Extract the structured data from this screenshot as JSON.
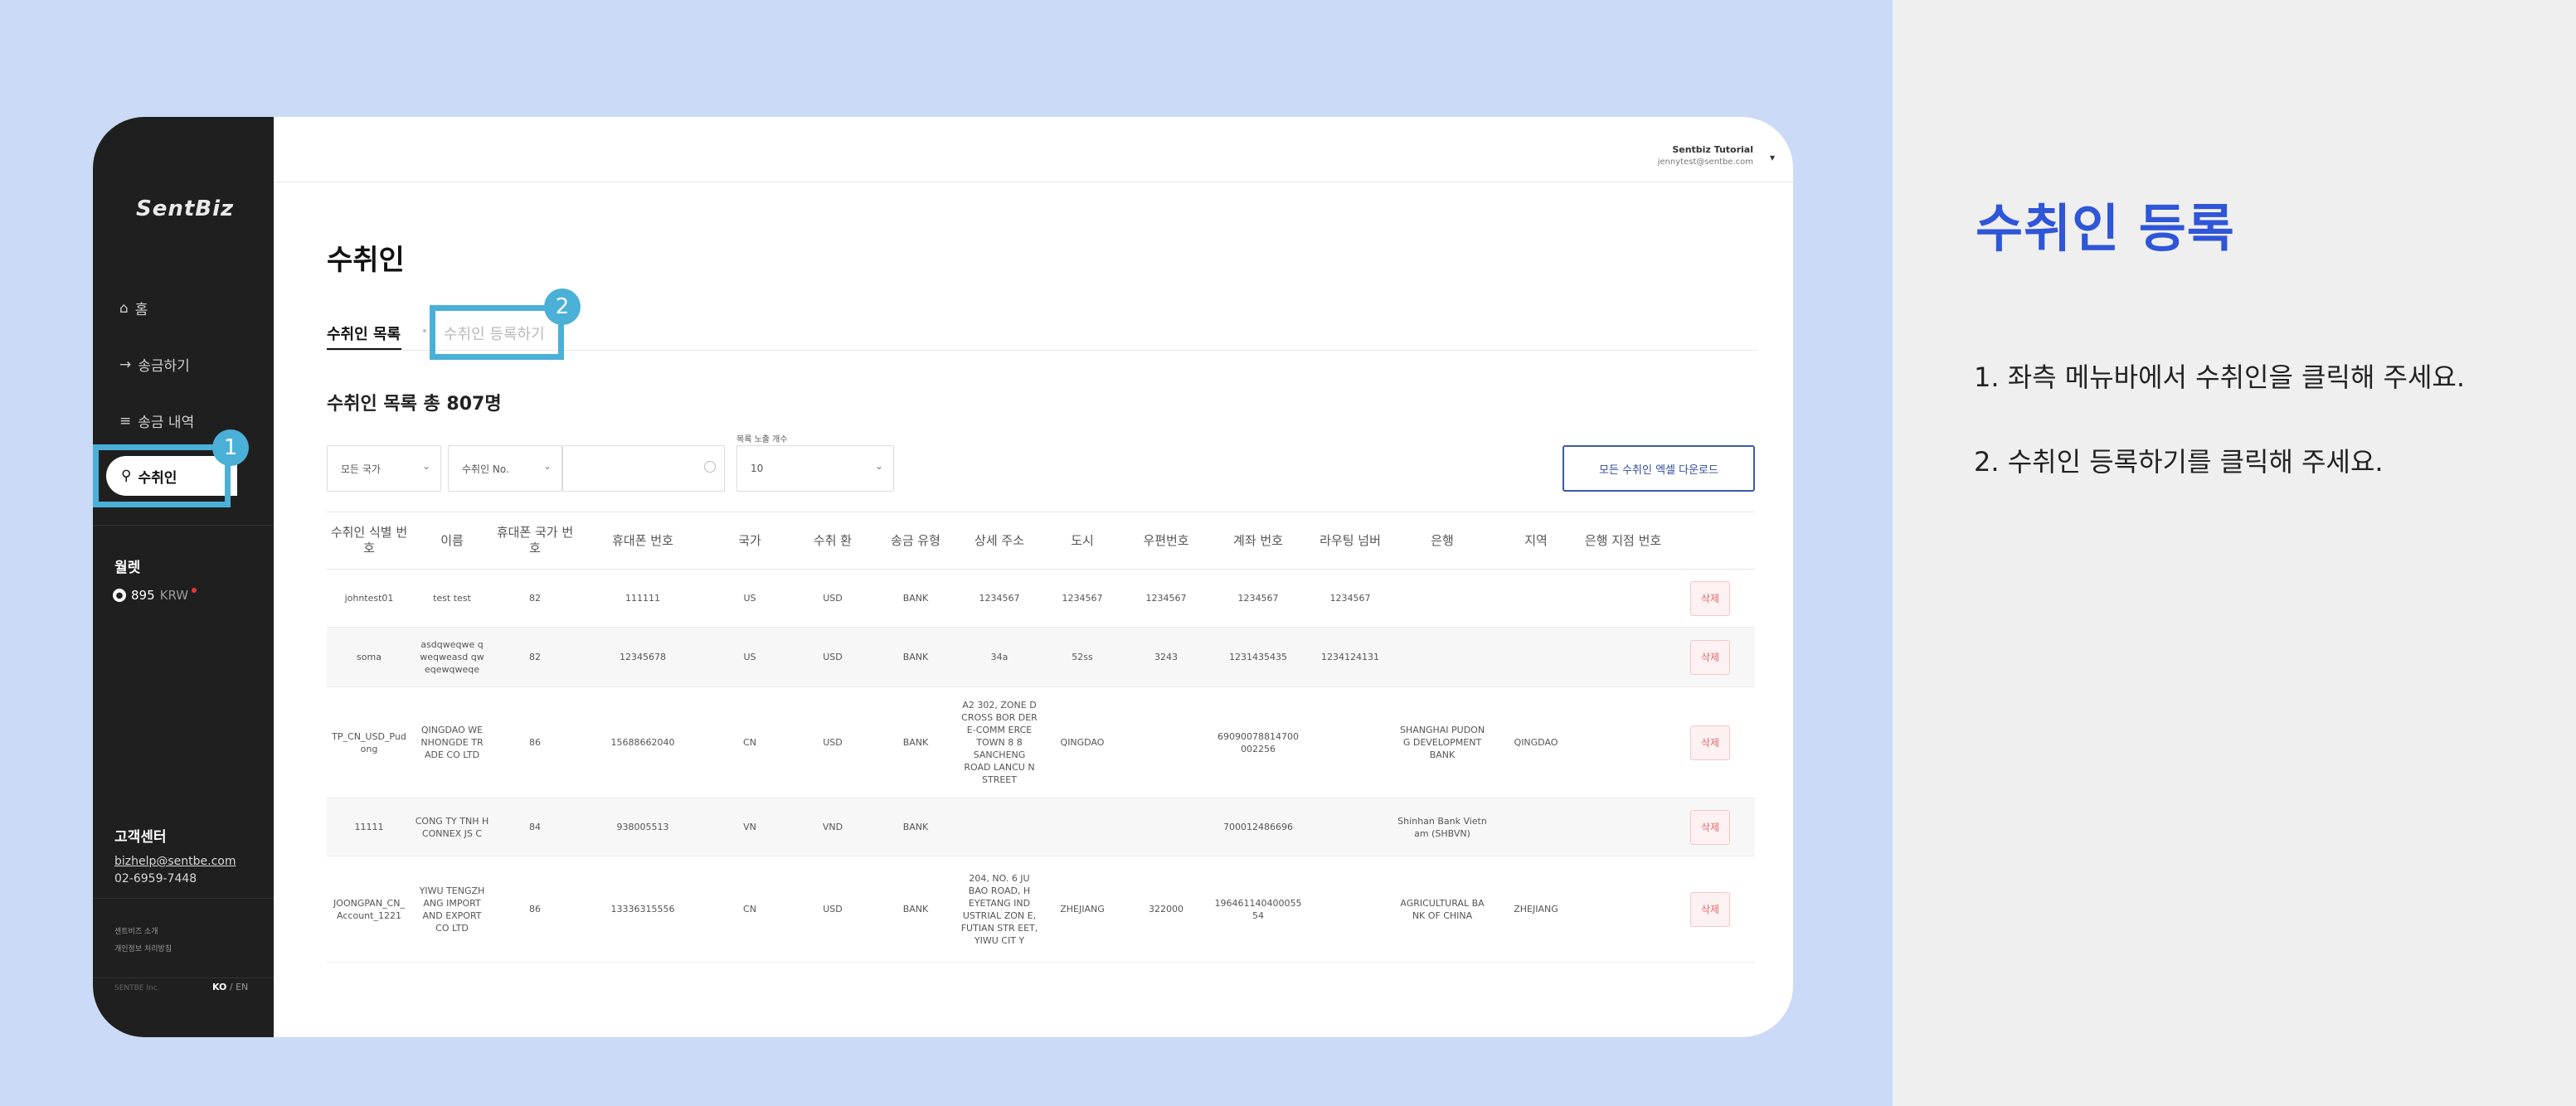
{
  "sidebar": {
    "logo": "SentBiz",
    "nav": {
      "home": "홈",
      "send": "송금하기",
      "history": "송금 내역",
      "recipients": "수취인"
    },
    "wallet": {
      "title": "월렛",
      "amount": "895",
      "currency": "KRW"
    },
    "support": {
      "title": "고객센터",
      "email": "bizhelp@sentbe.com",
      "phone": "02-6959-7448"
    },
    "links": {
      "about": "센트비즈 소개",
      "privacy": "개인정보 처리방침"
    },
    "company": "SENTBE Inc.",
    "lang": {
      "ko": "KO",
      "sep": "/",
      "en": "EN"
    }
  },
  "header": {
    "user_name": "Sentbiz Tutorial",
    "user_email": "jennytest@sentbe.com"
  },
  "main": {
    "title": "수취인",
    "tabs": {
      "list": "수취인 목록",
      "register": "수취인 등록하기"
    },
    "count_label": "수취인 목록 총 807명",
    "filters": {
      "country": "모든 국가",
      "recipient_no": "수취인 No.",
      "search_value": "",
      "page_size_label": "목록 노출 개수",
      "page_size": "10"
    },
    "download_label": "모든 수취인 엑셀 다운로드"
  },
  "table": {
    "headers": [
      "수취인 식별 번호",
      "이름",
      "휴대폰 국가 번호",
      "휴대폰 번호",
      "국가",
      "수취 환",
      "송금 유형",
      "상세 주소",
      "도시",
      "우편번호",
      "계좌 번호",
      "라우팅 넘버",
      "은행",
      "지역",
      "은행 지점 번호",
      ""
    ],
    "delete_label": "삭제",
    "rows": [
      [
        "johntest01",
        "test test",
        "82",
        "111111",
        "US",
        "USD",
        "BANK",
        "1234567",
        "1234567",
        "1234567",
        "1234567",
        "1234567",
        "",
        "",
        ""
      ],
      [
        "soma",
        "asdqweqwe q weqweasd qw eqewqweqe",
        "82",
        "12345678",
        "US",
        "USD",
        "BANK",
        "34a",
        "52ss",
        "3243",
        "1231435435",
        "1234124131",
        "",
        "",
        ""
      ],
      [
        "TP_CN_USD_Pud ong",
        "QINGDAO WE NHONGDE TR ADE CO LTD",
        "86",
        "15688662040",
        "CN",
        "USD",
        "BANK",
        "A2 302, ZONE D CROSS BOR DER E-COMM ERCE TOWN 8 8 SANCHENG ROAD LANCU N STREET",
        "QINGDAO",
        "",
        "69090078814700 002256",
        "",
        "SHANGHAI PUDON G DEVELOPMENT BANK",
        "QINGDAO",
        ""
      ],
      [
        "11111",
        "CONG TY TNH H CONNEX JS C",
        "84",
        "938005513",
        "VN",
        "VND",
        "BANK",
        "",
        "",
        "",
        "700012486696",
        "",
        "Shinhan Bank Vietn am (SHBVN)",
        "",
        ""
      ],
      [
        "JOONGPAN_CN_ Account_1221",
        "YIWU TENGZH ANG IMPORT AND EXPORT CO LTD",
        "86",
        "13336315556",
        "CN",
        "USD",
        "BANK",
        "204, NO. 6 JU BAO ROAD, H EYETANG IND USTRIAL ZON E, FUTIAN STR EET, YIWU CIT Y",
        "ZHEJIANG",
        "322000",
        "196461140400055 54",
        "",
        "AGRICULTURAL BA NK OF CHINA",
        "ZHEJIANG",
        ""
      ]
    ]
  },
  "callouts": {
    "badge1": "1",
    "badge2": "2"
  },
  "guide": {
    "title": "수취인 등록",
    "step1": "1. 좌측 메뉴바에서 수취인을 클릭해 주세요.",
    "step2": "2. 수취인 등록하기를 클릭해 주세요."
  },
  "colors": {
    "accent": "#2f56d8",
    "highlight": "#4bb0d8",
    "sidebar": "#1f1f1f",
    "background": "#cbdaf6",
    "panel": "#efefef"
  }
}
